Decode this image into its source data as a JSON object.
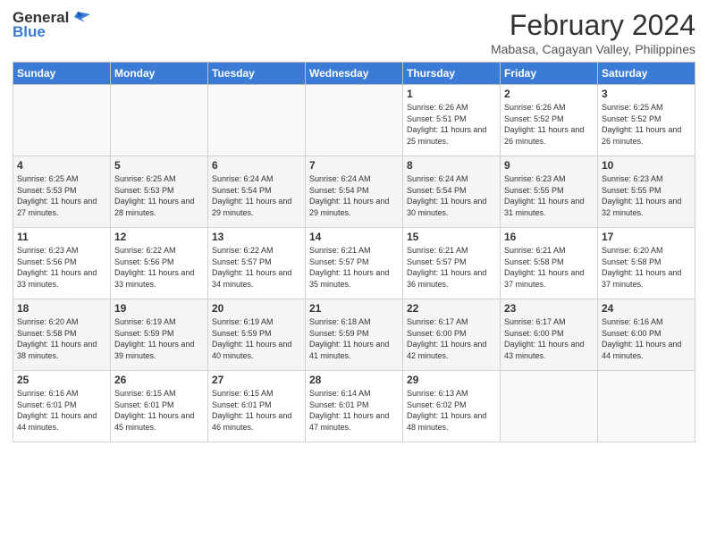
{
  "logo": {
    "general": "General",
    "blue": "Blue"
  },
  "header": {
    "month": "February 2024",
    "location": "Mabasa, Cagayan Valley, Philippines"
  },
  "days_of_week": [
    "Sunday",
    "Monday",
    "Tuesday",
    "Wednesday",
    "Thursday",
    "Friday",
    "Saturday"
  ],
  "weeks": [
    [
      {
        "day": "",
        "info": ""
      },
      {
        "day": "",
        "info": ""
      },
      {
        "day": "",
        "info": ""
      },
      {
        "day": "",
        "info": ""
      },
      {
        "day": "1",
        "info": "Sunrise: 6:26 AM\nSunset: 5:51 PM\nDaylight: 11 hours and 25 minutes."
      },
      {
        "day": "2",
        "info": "Sunrise: 6:26 AM\nSunset: 5:52 PM\nDaylight: 11 hours and 26 minutes."
      },
      {
        "day": "3",
        "info": "Sunrise: 6:25 AM\nSunset: 5:52 PM\nDaylight: 11 hours and 26 minutes."
      }
    ],
    [
      {
        "day": "4",
        "info": "Sunrise: 6:25 AM\nSunset: 5:53 PM\nDaylight: 11 hours and 27 minutes."
      },
      {
        "day": "5",
        "info": "Sunrise: 6:25 AM\nSunset: 5:53 PM\nDaylight: 11 hours and 28 minutes."
      },
      {
        "day": "6",
        "info": "Sunrise: 6:24 AM\nSunset: 5:54 PM\nDaylight: 11 hours and 29 minutes."
      },
      {
        "day": "7",
        "info": "Sunrise: 6:24 AM\nSunset: 5:54 PM\nDaylight: 11 hours and 29 minutes."
      },
      {
        "day": "8",
        "info": "Sunrise: 6:24 AM\nSunset: 5:54 PM\nDaylight: 11 hours and 30 minutes."
      },
      {
        "day": "9",
        "info": "Sunrise: 6:23 AM\nSunset: 5:55 PM\nDaylight: 11 hours and 31 minutes."
      },
      {
        "day": "10",
        "info": "Sunrise: 6:23 AM\nSunset: 5:55 PM\nDaylight: 11 hours and 32 minutes."
      }
    ],
    [
      {
        "day": "11",
        "info": "Sunrise: 6:23 AM\nSunset: 5:56 PM\nDaylight: 11 hours and 33 minutes."
      },
      {
        "day": "12",
        "info": "Sunrise: 6:22 AM\nSunset: 5:56 PM\nDaylight: 11 hours and 33 minutes."
      },
      {
        "day": "13",
        "info": "Sunrise: 6:22 AM\nSunset: 5:57 PM\nDaylight: 11 hours and 34 minutes."
      },
      {
        "day": "14",
        "info": "Sunrise: 6:21 AM\nSunset: 5:57 PM\nDaylight: 11 hours and 35 minutes."
      },
      {
        "day": "15",
        "info": "Sunrise: 6:21 AM\nSunset: 5:57 PM\nDaylight: 11 hours and 36 minutes."
      },
      {
        "day": "16",
        "info": "Sunrise: 6:21 AM\nSunset: 5:58 PM\nDaylight: 11 hours and 37 minutes."
      },
      {
        "day": "17",
        "info": "Sunrise: 6:20 AM\nSunset: 5:58 PM\nDaylight: 11 hours and 37 minutes."
      }
    ],
    [
      {
        "day": "18",
        "info": "Sunrise: 6:20 AM\nSunset: 5:58 PM\nDaylight: 11 hours and 38 minutes."
      },
      {
        "day": "19",
        "info": "Sunrise: 6:19 AM\nSunset: 5:59 PM\nDaylight: 11 hours and 39 minutes."
      },
      {
        "day": "20",
        "info": "Sunrise: 6:19 AM\nSunset: 5:59 PM\nDaylight: 11 hours and 40 minutes."
      },
      {
        "day": "21",
        "info": "Sunrise: 6:18 AM\nSunset: 5:59 PM\nDaylight: 11 hours and 41 minutes."
      },
      {
        "day": "22",
        "info": "Sunrise: 6:17 AM\nSunset: 6:00 PM\nDaylight: 11 hours and 42 minutes."
      },
      {
        "day": "23",
        "info": "Sunrise: 6:17 AM\nSunset: 6:00 PM\nDaylight: 11 hours and 43 minutes."
      },
      {
        "day": "24",
        "info": "Sunrise: 6:16 AM\nSunset: 6:00 PM\nDaylight: 11 hours and 44 minutes."
      }
    ],
    [
      {
        "day": "25",
        "info": "Sunrise: 6:16 AM\nSunset: 6:01 PM\nDaylight: 11 hours and 44 minutes."
      },
      {
        "day": "26",
        "info": "Sunrise: 6:15 AM\nSunset: 6:01 PM\nDaylight: 11 hours and 45 minutes."
      },
      {
        "day": "27",
        "info": "Sunrise: 6:15 AM\nSunset: 6:01 PM\nDaylight: 11 hours and 46 minutes."
      },
      {
        "day": "28",
        "info": "Sunrise: 6:14 AM\nSunset: 6:01 PM\nDaylight: 11 hours and 47 minutes."
      },
      {
        "day": "29",
        "info": "Sunrise: 6:13 AM\nSunset: 6:02 PM\nDaylight: 11 hours and 48 minutes."
      },
      {
        "day": "",
        "info": ""
      },
      {
        "day": "",
        "info": ""
      }
    ]
  ]
}
